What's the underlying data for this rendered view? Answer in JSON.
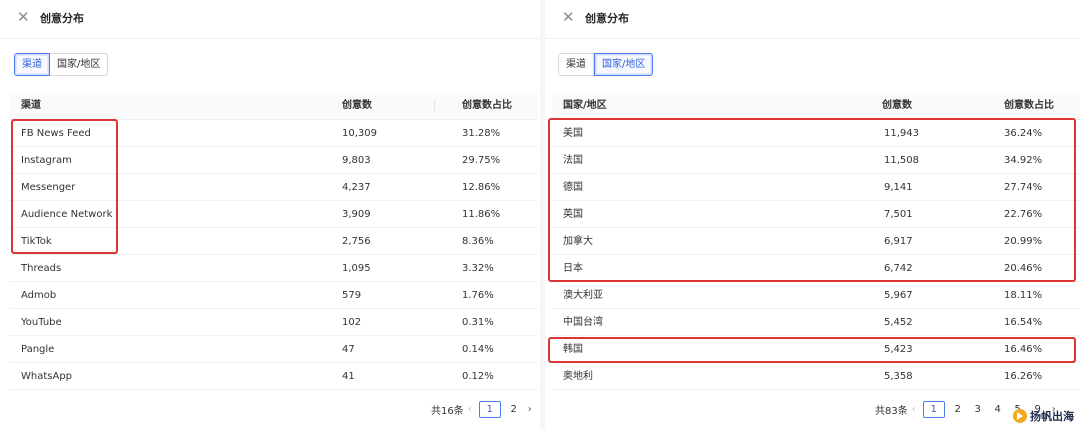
{
  "left": {
    "title": "创意分布",
    "tabs": [
      "渠道",
      "国家/地区"
    ],
    "columns": [
      "渠道",
      "创意数",
      "创意数占比"
    ],
    "rows": [
      [
        "FB News Feed",
        "10,309",
        "31.28%"
      ],
      [
        "Instagram",
        "9,803",
        "29.75%"
      ],
      [
        "Messenger",
        "4,237",
        "12.86%"
      ],
      [
        "Audience Network",
        "3,909",
        "11.86%"
      ],
      [
        "TikTok",
        "2,756",
        "8.36%"
      ],
      [
        "Threads",
        "1,095",
        "3.32%"
      ],
      [
        "Admob",
        "579",
        "1.76%"
      ],
      [
        "YouTube",
        "102",
        "0.31%"
      ],
      [
        "Pangle",
        "47",
        "0.14%"
      ],
      [
        "WhatsApp",
        "41",
        "0.12%"
      ]
    ],
    "pager": {
      "total": "共16条",
      "pages": [
        "1",
        "2"
      ],
      "current": "1",
      "prev": "‹",
      "next": "›"
    }
  },
  "right": {
    "title": "创意分布",
    "tabs": [
      "渠道",
      "国家/地区"
    ],
    "columns": [
      "国家/地区",
      "创意数",
      "创意数占比"
    ],
    "rows": [
      [
        "美国",
        "11,943",
        "36.24%"
      ],
      [
        "法国",
        "11,508",
        "34.92%"
      ],
      [
        "德国",
        "9,141",
        "27.74%"
      ],
      [
        "英国",
        "7,501",
        "22.76%"
      ],
      [
        "加拿大",
        "6,917",
        "20.99%"
      ],
      [
        "日本",
        "6,742",
        "20.46%"
      ],
      [
        "澳大利亚",
        "5,967",
        "18.11%"
      ],
      [
        "中国台湾",
        "5,452",
        "16.54%"
      ],
      [
        "韩国",
        "5,423",
        "16.46%"
      ],
      [
        "奥地利",
        "5,358",
        "16.26%"
      ]
    ],
    "pager": {
      "total": "共83条",
      "pages": [
        "1",
        "2",
        "3",
        "4",
        "5",
        "9"
      ],
      "current": "1",
      "prev": "‹",
      "next": "›"
    }
  },
  "close_icon": "close-icon",
  "watermark": "扬帆出海",
  "colors": {
    "accent": "#4d7cf1",
    "highlight": "#d93535"
  }
}
